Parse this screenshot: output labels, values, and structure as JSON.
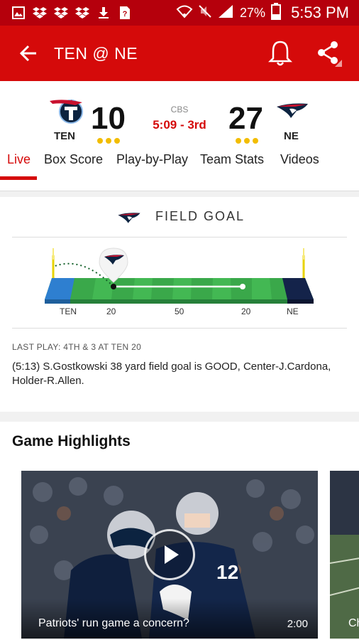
{
  "status_bar": {
    "battery": "27%",
    "time": "5:53 PM",
    "icons": [
      "gallery-icon",
      "dropbox-icon",
      "dropbox-icon",
      "dropbox-icon",
      "download-icon",
      "file-icon",
      "wifi-icon",
      "mute-icon",
      "signal-icon",
      "battery-icon"
    ]
  },
  "app_bar": {
    "title": "TEN @ NE",
    "icons": [
      "back-arrow-icon",
      "bell-icon",
      "share-icon"
    ]
  },
  "scoreboard": {
    "away": {
      "abbr": "TEN",
      "score": "10",
      "timeouts": 3
    },
    "home": {
      "abbr": "NE",
      "score": "27",
      "timeouts": 3
    },
    "network": "CBS",
    "clock": "5:09 - 3rd",
    "colors": {
      "accent": "#d50a0a",
      "timeout_dot": "#f2bd00"
    }
  },
  "tabs": [
    {
      "label": "Live",
      "active": true
    },
    {
      "label": "Box Score",
      "active": false
    },
    {
      "label": "Play-by-Play",
      "active": false
    },
    {
      "label": "Team Stats",
      "active": false
    },
    {
      "label": "Videos",
      "active": false
    }
  ],
  "play_card": {
    "title": "FIELD GOAL",
    "field_labels": {
      "left_end": "TEN",
      "left_20": "20",
      "mid": "50",
      "right_20": "20",
      "right_end": "NE"
    },
    "last_play_label": "LAST PLAY: 4TH & 3 AT TEN 20",
    "last_play_text": "(5:13) S.Gostkowski 38 yard field goal is GOOD, Center-J.Cardona, Holder-R.Allen."
  },
  "highlights": {
    "title": "Game Highlights",
    "videos": [
      {
        "caption": "Patriots' run game a concern?",
        "duration": "2:00"
      },
      {
        "caption": "Ch",
        "duration": ""
      }
    ]
  }
}
